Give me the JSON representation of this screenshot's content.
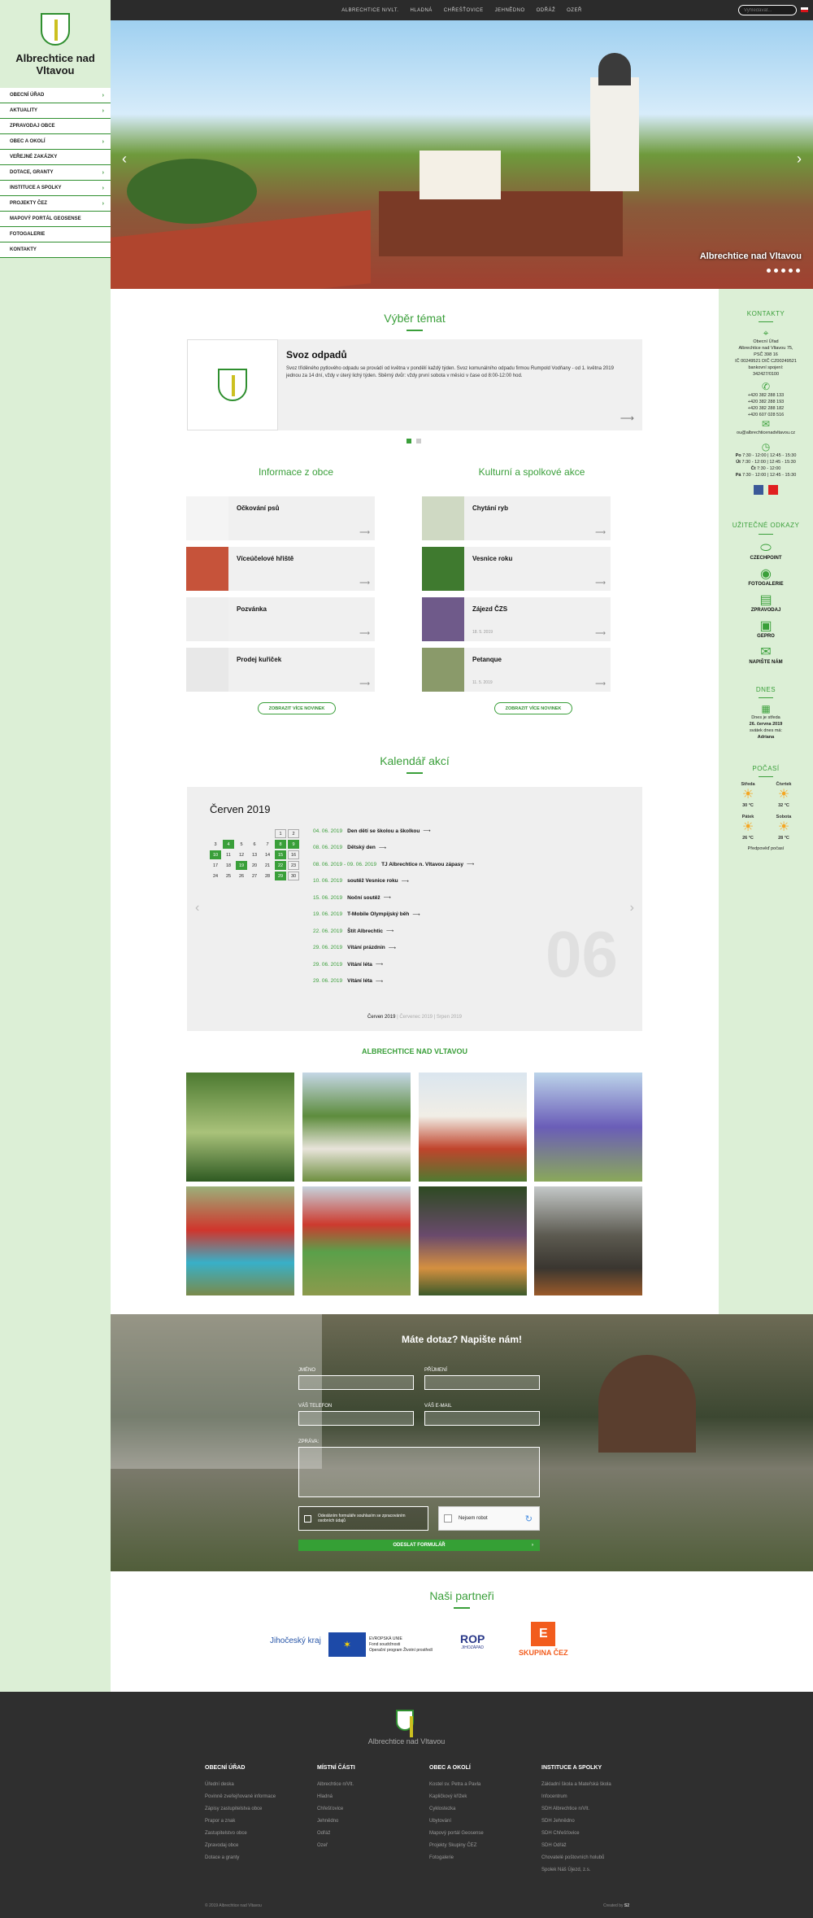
{
  "sidebar": {
    "brand": "Albrechtice nad Vltavou",
    "nav": [
      {
        "label": "OBECNÍ ÚŘAD",
        "chevron": true
      },
      {
        "label": "AKTUALITY",
        "chevron": true
      },
      {
        "label": "ZPRAVODAJ OBCE",
        "chevron": false
      },
      {
        "label": "OBEC A OKOLÍ",
        "chevron": true
      },
      {
        "label": "VEŘEJNÉ ZAKÁZKY",
        "chevron": false
      },
      {
        "label": "DOTACE, GRANTY",
        "chevron": true
      },
      {
        "label": "INSTITUCE A SPOLKY",
        "chevron": true
      },
      {
        "label": "PROJEKTY ČEZ",
        "chevron": true
      },
      {
        "label": "MAPOVÝ PORTÁL GEOSENSE",
        "chevron": false
      },
      {
        "label": "FOTOGALERIE",
        "chevron": false
      },
      {
        "label": "KONTAKTY",
        "chevron": false
      }
    ]
  },
  "topbar": {
    "menu": [
      "ALBRECHTICE N/VLT.",
      "HLADNÁ",
      "CHŘEŠŤOVICE",
      "JEHNĚDNO",
      "ODŘÁŽ",
      "OZEŘ"
    ],
    "search_placeholder": "Vyhledávat..."
  },
  "hero": {
    "caption": "Albrechtice nad Vltavou",
    "prev": "‹",
    "next": "›"
  },
  "topics": {
    "title": "Výběr témat",
    "item_title": "Svoz odpadů",
    "item_text": "Svoz tříděného pytlového odpadu se provádí od května v pondělí každý týden. Svoz komunálního odpadu firmou Rumpold Vodňany - od 1. května 2019 jednou za 14 dní, vždy v úterý lichý týden. Sběrný dvůr: vždy první sobota v měsíci v čase od 8:00-12:00 hod.",
    "arrow": "⟶"
  },
  "info": {
    "title": "Informace z obce",
    "items": [
      {
        "title": "Očkování psů",
        "date": ""
      },
      {
        "title": "Víceúčelové hřiště",
        "date": ""
      },
      {
        "title": "Pozvánka",
        "date": ""
      },
      {
        "title": "Prodej kuřiček",
        "date": ""
      }
    ],
    "more": "ZOBRAZIT VÍCE NOVINEK"
  },
  "culture": {
    "title": "Kulturní a spolkové akce",
    "items": [
      {
        "title": "Chytání ryb",
        "date": ""
      },
      {
        "title": "Vesnice roku",
        "date": ""
      },
      {
        "title": "Zájezd ČZS",
        "date": "18. 5. 2019"
      },
      {
        "title": "Petanque",
        "date": "11. 5. 2019"
      }
    ],
    "more": "ZOBRAZIT VÍCE NOVINEK"
  },
  "calendar": {
    "title": "Kalendář akcí",
    "month": "Červen 2019",
    "days": [
      "",
      "",
      "",
      "",
      "",
      "1",
      "2",
      "3",
      "4",
      "5",
      "6",
      "7",
      "8",
      "9",
      "10",
      "11",
      "12",
      "13",
      "14",
      "15",
      "16",
      "17",
      "18",
      "19",
      "20",
      "21",
      "22",
      "23",
      "24",
      "25",
      "26",
      "27",
      "28",
      "29",
      "30"
    ],
    "highlight": [
      "4",
      "8",
      "9",
      "10",
      "15",
      "19",
      "22",
      "29"
    ],
    "boxed": [
      "1",
      "2",
      "16",
      "23",
      "30"
    ],
    "events": [
      {
        "date": "04. 06. 2019",
        "name": "Den dětí se školou a školkou"
      },
      {
        "date": "08. 06. 2019",
        "name": "Dětský den"
      },
      {
        "date": "08. 06. 2019 - 09. 06. 2019",
        "name": "TJ Albrechtice n. Vltavou zápasy"
      },
      {
        "date": "10. 06. 2019",
        "name": "soutěž Vesnice roku"
      },
      {
        "date": "15. 06. 2019",
        "name": "Noční soutěž"
      },
      {
        "date": "19. 06. 2019",
        "name": "T-Mobile Olympijský běh"
      },
      {
        "date": "22. 06. 2019",
        "name": "Štít Albrechtic"
      },
      {
        "date": "29. 06. 2019",
        "name": "Vítání prázdnin"
      },
      {
        "date": "29. 06. 2019",
        "name": "Vítání léta"
      },
      {
        "date": "29. 06. 2019",
        "name": "Vítání léta"
      }
    ],
    "big": "06",
    "foot_active": "Červen 2019",
    "foot": [
      "Červenec 2019",
      "Srpen 2019"
    ]
  },
  "gallery": {
    "title": "ALBRECHTICE NAD VLTAVOU"
  },
  "right": {
    "contact_title": "KONTAKTY",
    "contact_lines": [
      "Obecní Úřad",
      "Albrechtice nad Vltavou 75,",
      "PSČ 398 16",
      "IČ 00249521   DIČ CZ00249521",
      "bankovní spojení:",
      "342427/0100"
    ],
    "phones": [
      "+420 382 288 133",
      "+420 382 288 193",
      "+420 382 288 182",
      "+420 607 028 516"
    ],
    "email": "ou@albrechticenadvltavou.cz",
    "hours": [
      {
        "day": "Po",
        "time": "7:30 - 12:00 | 12:45 - 15:30"
      },
      {
        "day": "Út",
        "time": "7:30 - 12:00 | 12:45 - 15:30"
      },
      {
        "day": "Čt",
        "time": "7:30 - 12:00"
      },
      {
        "day": "Pá",
        "time": "7:30 - 12:00 | 12:45 - 15:30"
      }
    ],
    "links_title": "UŽITEČNÉ ODKAZY",
    "links": [
      "CZECHPOINT",
      "FOTOGALERIE",
      "ZPRAVODAJ",
      "GEPRO",
      "NAPIŠTE NÁM"
    ],
    "today_title": "DNES",
    "today_text": "Dnes je středa",
    "today_date": "26. června 2019",
    "today_name_label": "svátek dnes má:",
    "today_name": "Adriana",
    "weather_title": "POČASÍ",
    "weather": [
      {
        "day": "Středa",
        "temp": "30 °C"
      },
      {
        "day": "Čtvrtek",
        "temp": "32 °C"
      },
      {
        "day": "Pátek",
        "temp": "26 °C"
      },
      {
        "day": "Sobota",
        "temp": "28 °C"
      }
    ],
    "weather_note": "Předpověď počasí"
  },
  "contact": {
    "title": "Máte dotaz? Napište nám!",
    "labels": [
      "JMÉNO",
      "PŘÍJMENÍ",
      "VÁŠ TELEFON",
      "VÁŠ E-MAIL",
      "ZPRÁVA:"
    ],
    "consent": "Odesláním formuláře souhlasím se zpracováním osobních údajů",
    "captcha": "Nejsem robot",
    "send": "ODESLAT FORMULÁŘ"
  },
  "partners": {
    "title": "Naši partneři",
    "items": [
      "Jihočeský kraj",
      "EVROPSKÁ UNIE",
      "Fond soudržnosti",
      "Operační program Životní prostředí",
      "ROP",
      "JIHOZÁPAD",
      "SKUPINA ČEZ"
    ]
  },
  "footer": {
    "brand": "Albrechtice nad Vltavou",
    "cols": [
      {
        "title": "OBECNÍ ÚŘAD",
        "items": [
          "Úřední deska",
          "Povinně zveřejňované informace",
          "Zápisy zastupitelstva obce",
          "Prapor a znak",
          "Zastupitelstvo obce",
          "Zpravodaj obce",
          "Dotace a granty"
        ]
      },
      {
        "title": "MÍSTNÍ ČÁSTI",
        "items": [
          "Albrechtice n/Vlt.",
          "Hladná",
          "Chřešťovice",
          "Jehnědno",
          "Odřáž",
          "Ozeř"
        ]
      },
      {
        "title": "OBEC A OKOLÍ",
        "items": [
          "Kostel sv. Petra a Pavla",
          "Kapličkový křížek",
          "Cyklostezka",
          "Ubytování",
          "Mapový portál Geosense",
          "Projekty Skupiny ČEZ",
          "Fotogalerie"
        ]
      },
      {
        "title": "INSTITUCE A SPOLKY",
        "items": [
          "Základní škola a Mateřská škola",
          "Infocentrum",
          "SDH Albrechtice n/Vlt.",
          "SDH Jehnědno",
          "SDH Chřešťovice",
          "SDH Odřáž",
          "Chovatelé poštovních holubů",
          "Spolek Náš Újezd, z.s."
        ]
      }
    ],
    "copyright": "© 2019 Albrechtice nad Vltavou",
    "created": "Created by"
  },
  "colors": {
    "accent": "#3a9f3a",
    "sidebar_bg": "#dcefd6",
    "footer_bg": "#2f2f2f",
    "topbar_bg": "#2b2b2b"
  }
}
